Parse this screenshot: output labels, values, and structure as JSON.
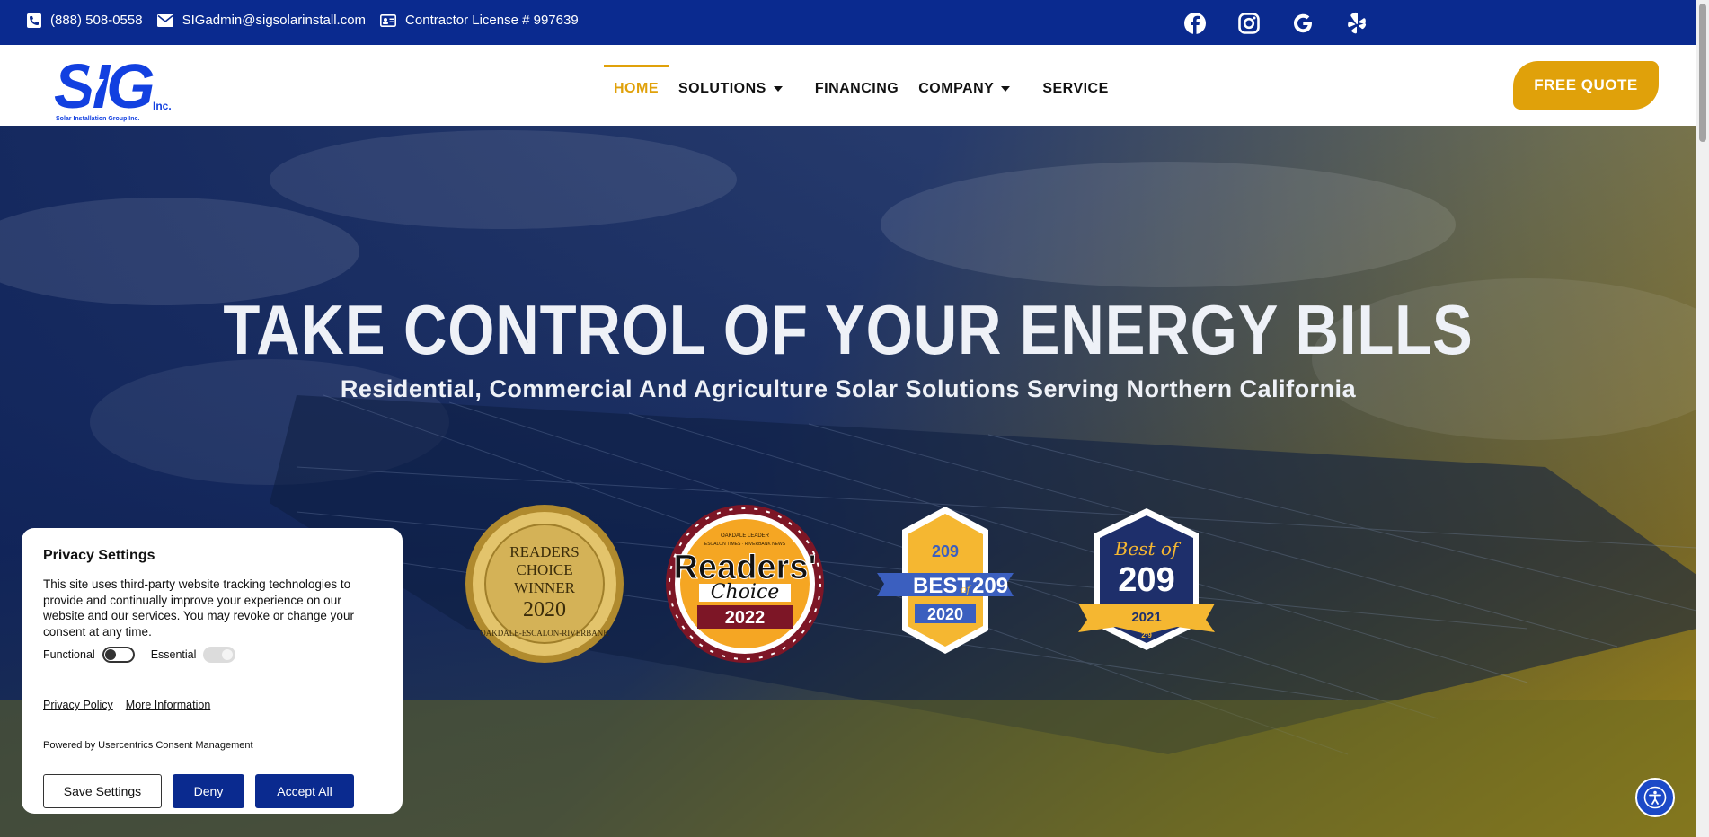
{
  "topbar": {
    "phone": "(888) 508-0558",
    "email": "SIGadmin@sigsolarinstall.com",
    "license": "Contractor License # 997639",
    "socials": [
      "facebook-icon",
      "instagram-icon",
      "google-icon",
      "yelp-icon"
    ]
  },
  "logo": {
    "main": "SIG",
    "suffix": "Inc.",
    "tagline": "Solar Installation Group Inc."
  },
  "nav": {
    "items": [
      {
        "label": "HOME",
        "active": true,
        "dropdown": false
      },
      {
        "label": "SOLUTIONS",
        "dropdown": true
      },
      {
        "label": "FINANCING",
        "dropdown": false
      },
      {
        "label": "COMPANY",
        "dropdown": true
      },
      {
        "label": "SERVICE",
        "dropdown": false
      }
    ],
    "cta": "FREE QUOTE"
  },
  "hero": {
    "title": "TAKE CONTROL OF YOUR ENERGY BILLS",
    "subtitle": "Residential, Commercial And Agriculture Solar Solutions Serving Northern California"
  },
  "badges": {
    "b1": {
      "line1": "READERS",
      "line2": "CHOICE",
      "line3": "WINNER",
      "year": "2020",
      "arc": "OAKDALE-ESCALON-RIVERBANK"
    },
    "b2": {
      "top1": "OAKDALE LEADER",
      "top2": "ESCALON TIMES · RIVERBANK NEWS",
      "main": "Readers'",
      "script": "Choice",
      "year": "2022"
    },
    "b3": {
      "top": "209",
      "main": "BEST",
      "of": "of",
      "num": "209",
      "year": "2020"
    },
    "b4": {
      "script": "Best of",
      "num": "209",
      "year": "2021",
      "small": "2·9"
    }
  },
  "privacy": {
    "title": "Privacy Settings",
    "text": "This site uses third-party website tracking technologies to provide and continually improve your experience on our website and our services. You may revoke or change your consent at any time.",
    "toggle_functional": "Functional",
    "toggle_essential": "Essential",
    "link_policy": "Privacy Policy",
    "link_more": "More Information",
    "powered": "Powered by Usercentrics Consent Management",
    "btn_save": "Save Settings",
    "btn_deny": "Deny",
    "btn_accept": "Accept All"
  },
  "colors": {
    "brand_blue": "#0a2a8f",
    "accent_gold": "#e0a10a"
  }
}
